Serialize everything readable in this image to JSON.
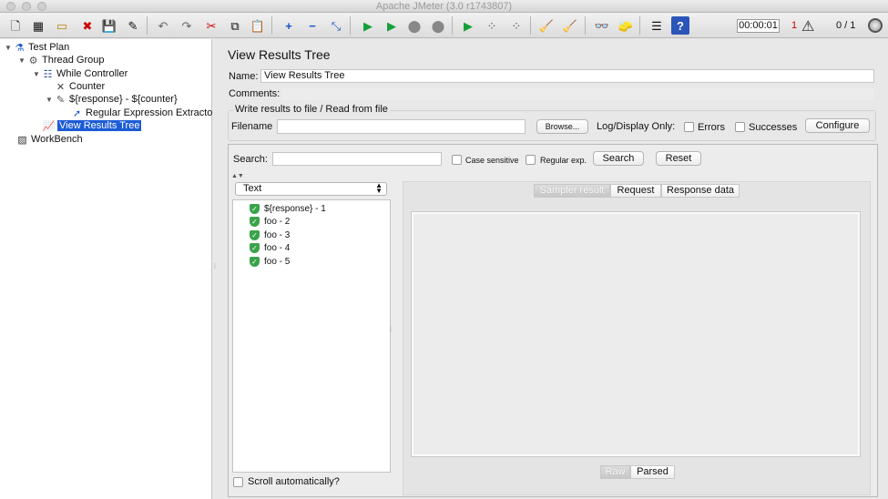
{
  "window": {
    "title": "Apache JMeter (3.0 r1743807)"
  },
  "toolbar": {
    "timer": "00:00:01",
    "error_count": "1",
    "thread_ratio": "0 / 1"
  },
  "tree": {
    "items": [
      {
        "label": "Test Plan",
        "icon": "test-plan-icon"
      },
      {
        "label": "Thread Group",
        "icon": "gear-icon"
      },
      {
        "label": "While Controller",
        "icon": "controller-icon"
      },
      {
        "label": "Counter",
        "icon": "tools-icon"
      },
      {
        "label": "${response} - ${counter}",
        "icon": "sampler-icon"
      },
      {
        "label": "Regular Expression Extractor",
        "icon": "extractor-icon"
      },
      {
        "label": "View Results Tree",
        "icon": "listener-icon"
      },
      {
        "label": "WorkBench",
        "icon": "workbench-icon"
      }
    ]
  },
  "panel": {
    "title": "View Results Tree",
    "name_label": "Name:",
    "name_value": "View Results Tree",
    "comments_label": "Comments:",
    "file_section": "Write results to file / Read from file",
    "filename_label": "Filename",
    "browse_button": "Browse...",
    "log_display_label": "Log/Display Only:",
    "errors_label": "Errors",
    "successes_label": "Successes",
    "configure_button": "Configure"
  },
  "results": {
    "search_label": "Search:",
    "case_sensitive_label": "Case sensitive",
    "regular_exp_label": "Regular exp.",
    "search_button": "Search",
    "reset_button": "Reset",
    "renderer_selected": "Text",
    "samples": [
      {
        "label": "${response} - 1"
      },
      {
        "label": "foo - 2"
      },
      {
        "label": "foo - 3"
      },
      {
        "label": "foo - 4"
      },
      {
        "label": "foo - 5"
      }
    ],
    "tabs": [
      "Sampler result",
      "Request",
      "Response data"
    ],
    "active_tab": "Sampler result",
    "view_buttons": [
      "Raw",
      "Parsed"
    ],
    "scroll_auto_label": "Scroll automatically?"
  }
}
